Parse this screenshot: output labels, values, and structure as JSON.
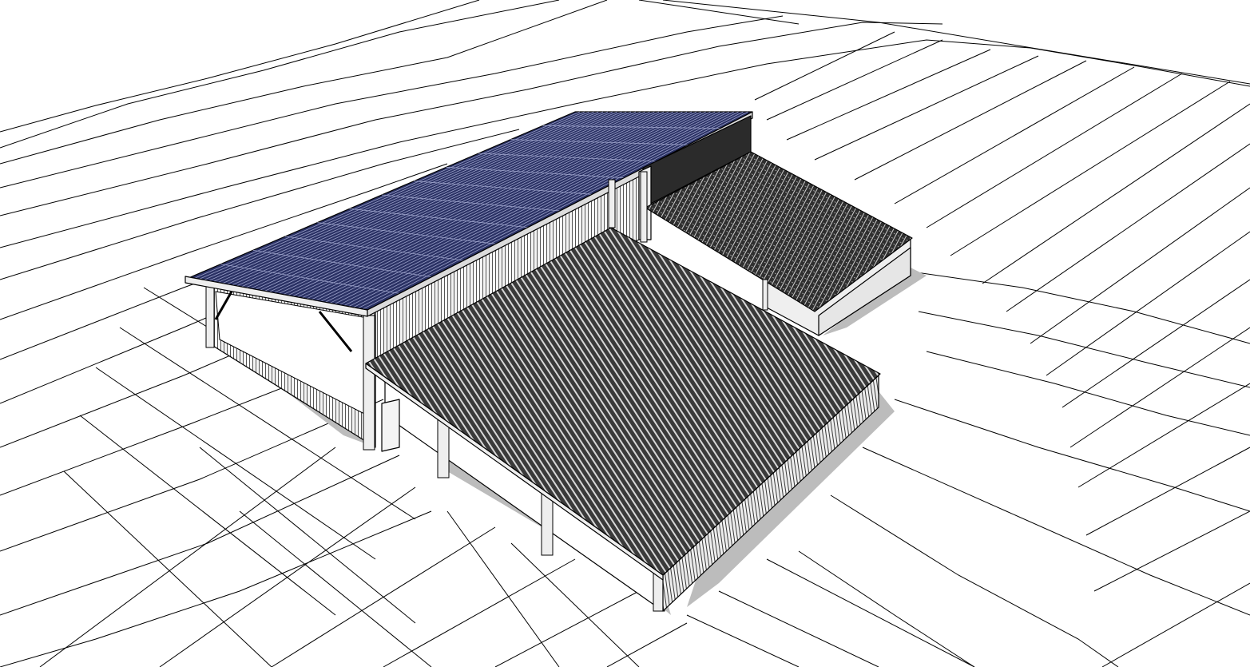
{
  "scene": {
    "kind": "3d-model-viewport",
    "background": "#ffffff",
    "colors": {
      "terrain_line": "#000000",
      "solar_panel": "#2a3164",
      "solar_panel_grid": "#9aa0c8",
      "metal_roof_dark": "#3a3a3a",
      "metal_roof_rib": "#d8d8d8",
      "wall_light": "#f2f2f2",
      "wall_mid": "#d9d9d9",
      "shadow": "#b3b3b3"
    },
    "objects": [
      {
        "id": "solar-roof",
        "label": ""
      },
      {
        "id": "main-metal-roof",
        "label": ""
      },
      {
        "id": "annex-textured-roof",
        "label": ""
      }
    ]
  }
}
